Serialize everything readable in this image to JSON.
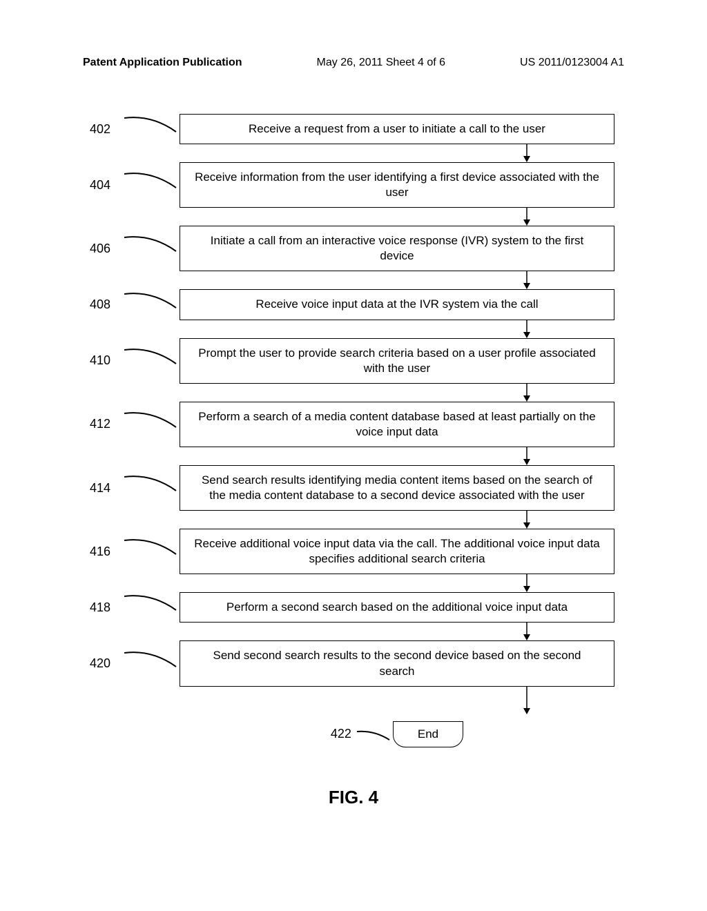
{
  "header": {
    "left": "Patent Application Publication",
    "center": "May 26, 2011  Sheet 4 of 6",
    "right": "US 2011/0123004 A1"
  },
  "steps": [
    {
      "num": "402",
      "text": "Receive a request from a user to initiate a call to the user"
    },
    {
      "num": "404",
      "text": "Receive information from the user identifying a first device associated with the user"
    },
    {
      "num": "406",
      "text": "Initiate a call from an interactive voice response (IVR) system to the first device"
    },
    {
      "num": "408",
      "text": "Receive voice input data at the IVR system via the call"
    },
    {
      "num": "410",
      "text": "Prompt the user to provide search criteria based on a user profile associated with the user"
    },
    {
      "num": "412",
      "text": "Perform a search of a media content database based at least partially on the voice input data"
    },
    {
      "num": "414",
      "text": "Send search results identifying media content items based on the search of the media content database to a second device associated with the user"
    },
    {
      "num": "416",
      "text": "Receive additional voice input data via the call.  The additional voice input data specifies additional search criteria"
    },
    {
      "num": "418",
      "text": "Perform a second search based on the additional voice input data"
    },
    {
      "num": "420",
      "text": "Send second search results to the second device based on the second search"
    }
  ],
  "end": {
    "num": "422",
    "text": "End"
  },
  "figure": "FIG. 4"
}
